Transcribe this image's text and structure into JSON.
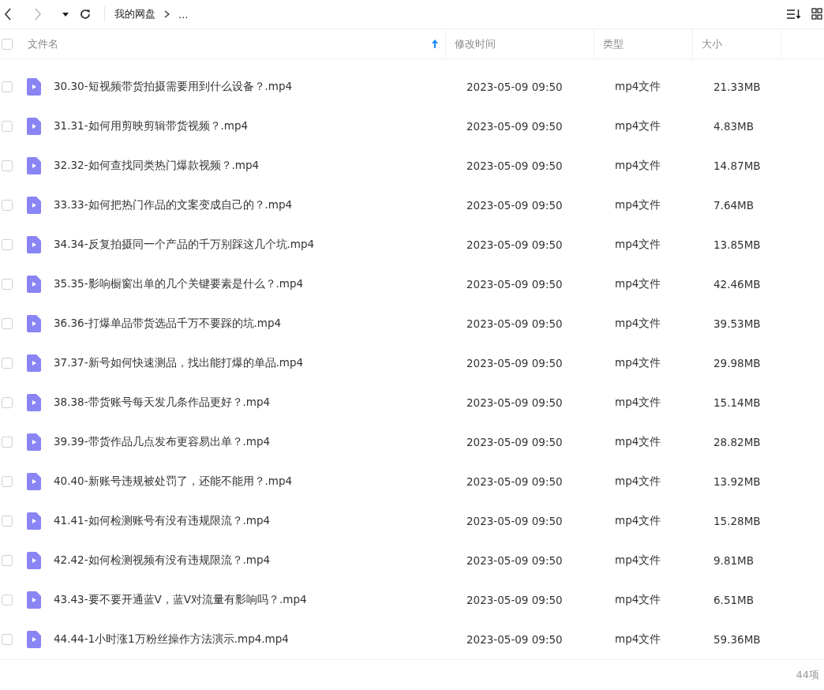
{
  "toolbar": {
    "breadcrumb": [
      {
        "label": "我的网盘"
      },
      {
        "label": "..."
      }
    ]
  },
  "table": {
    "select_all": {
      "checked": false
    },
    "columns": [
      {
        "label": "文件名",
        "sorted": true
      },
      {
        "label": "修改时间"
      },
      {
        "label": "类型"
      },
      {
        "label": "大小"
      }
    ],
    "rows": [
      {
        "name": "30.30-短视频带货拍摄需要用到什么设备？.mp4",
        "modified": "2023-05-09 09:50",
        "type": "mp4文件",
        "size": "21.33MB",
        "checked": false
      },
      {
        "name": "31.31-如何用剪映剪辑带货视频？.mp4",
        "modified": "2023-05-09 09:50",
        "type": "mp4文件",
        "size": "4.83MB",
        "checked": false
      },
      {
        "name": "32.32-如何查找同类热门爆款视频？.mp4",
        "modified": "2023-05-09 09:50",
        "type": "mp4文件",
        "size": "14.87MB",
        "checked": false
      },
      {
        "name": "33.33-如何把热门作品的文案变成自己的？.mp4",
        "modified": "2023-05-09 09:50",
        "type": "mp4文件",
        "size": "7.64MB",
        "checked": false
      },
      {
        "name": "34.34-反复拍摄同一个产品的千万别踩这几个坑.mp4",
        "modified": "2023-05-09 09:50",
        "type": "mp4文件",
        "size": "13.85MB",
        "checked": false
      },
      {
        "name": "35.35-影响橱窗出单的几个关键要素是什么？.mp4",
        "modified": "2023-05-09 09:50",
        "type": "mp4文件",
        "size": "42.46MB",
        "checked": false
      },
      {
        "name": "36.36-打爆单品带货选品千万不要踩的坑.mp4",
        "modified": "2023-05-09 09:50",
        "type": "mp4文件",
        "size": "39.53MB",
        "checked": false
      },
      {
        "name": "37.37-新号如何快速测品，找出能打爆的单品.mp4",
        "modified": "2023-05-09 09:50",
        "type": "mp4文件",
        "size": "29.98MB",
        "checked": false
      },
      {
        "name": "38.38-带货账号每天发几条作品更好？.mp4",
        "modified": "2023-05-09 09:50",
        "type": "mp4文件",
        "size": "15.14MB",
        "checked": false
      },
      {
        "name": "39.39-带货作品几点发布更容易出单？.mp4",
        "modified": "2023-05-09 09:50",
        "type": "mp4文件",
        "size": "28.82MB",
        "checked": false
      },
      {
        "name": "40.40-新账号违规被处罚了，还能不能用？.mp4",
        "modified": "2023-05-09 09:50",
        "type": "mp4文件",
        "size": "13.92MB",
        "checked": false
      },
      {
        "name": "41.41-如何检测账号有没有违规限流？.mp4",
        "modified": "2023-05-09 09:50",
        "type": "mp4文件",
        "size": "15.28MB",
        "checked": false
      },
      {
        "name": "42.42-如何检测视频有没有违规限流？.mp4",
        "modified": "2023-05-09 09:50",
        "type": "mp4文件",
        "size": "9.81MB",
        "checked": false
      },
      {
        "name": "43.43-要不要开通蓝V，蓝V对流量有影响吗？.mp4",
        "modified": "2023-05-09 09:50",
        "type": "mp4文件",
        "size": "6.51MB",
        "checked": false
      },
      {
        "name": "44.44-1小时涨1万粉丝操作方法演示.mp4.mp4",
        "modified": "2023-05-09 09:50",
        "type": "mp4文件",
        "size": "59.36MB",
        "checked": false
      }
    ]
  },
  "footer": {
    "count": "44项"
  }
}
